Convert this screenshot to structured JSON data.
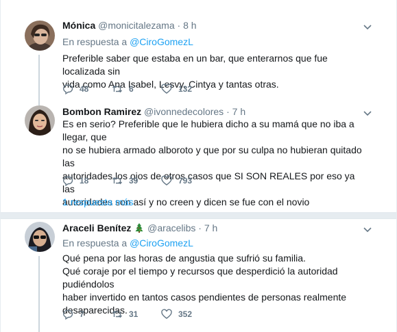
{
  "tweets": [
    {
      "name": "Mónica",
      "handle": "@monicitalezama",
      "time": "8 h",
      "reply_prefix": "En respuesta a",
      "reply_to": "@CiroGomezL",
      "lines": [
        "Preferible saber que estaba en un bar, que enterarnos que fue localizada sin",
        "vida como Ana Isabel, Lesvy, Cintya y tantas otras."
      ],
      "replies": "48",
      "retweets": "6",
      "likes": "132"
    },
    {
      "name": "Bombon Ramirez",
      "handle": "@ivonnedecolores",
      "time": "7 h",
      "lines": [
        "Es en serio? Preferible que le hubiera dicho a su mamá que no iba a llegar, que",
        "no se hubiera armado alboroto y que por su culpa no hubieran quitado las",
        "autoridades los ojos de otros casos que SI SON REALES por eso ya las",
        "autoridades son así y no creen y dicen se fue con el novio"
      ],
      "replies": "18",
      "retweets": "39",
      "likes": "793",
      "more_replies": "1 respuesta más"
    },
    {
      "name": "Araceli Benítez",
      "name_emoji": "christmas-tree",
      "handle": "@aracelibs",
      "time": "7 h",
      "reply_prefix": "En respuesta a",
      "reply_to": "@CiroGomezL",
      "lines": [
        "Qué pena por las horas de angustia que sufrió su familia.",
        "Qué coraje por el tiempo y recursos que desperdició la autoridad pudiéndolos",
        "haber invertido en tantos casos pendientes de personas realmente",
        "desaparecidas."
      ],
      "replies": "7",
      "retweets": "31",
      "likes": "352"
    }
  ],
  "separator": "·",
  "icons": [
    "reply-icon",
    "retweet-icon",
    "like-icon",
    "chevron-down-icon",
    "christmas-tree-icon"
  ],
  "colors": {
    "link": "#1da1f2",
    "muted": "#657786",
    "thread_line": "#ccd6dd",
    "divider": "#e6ecf0"
  }
}
